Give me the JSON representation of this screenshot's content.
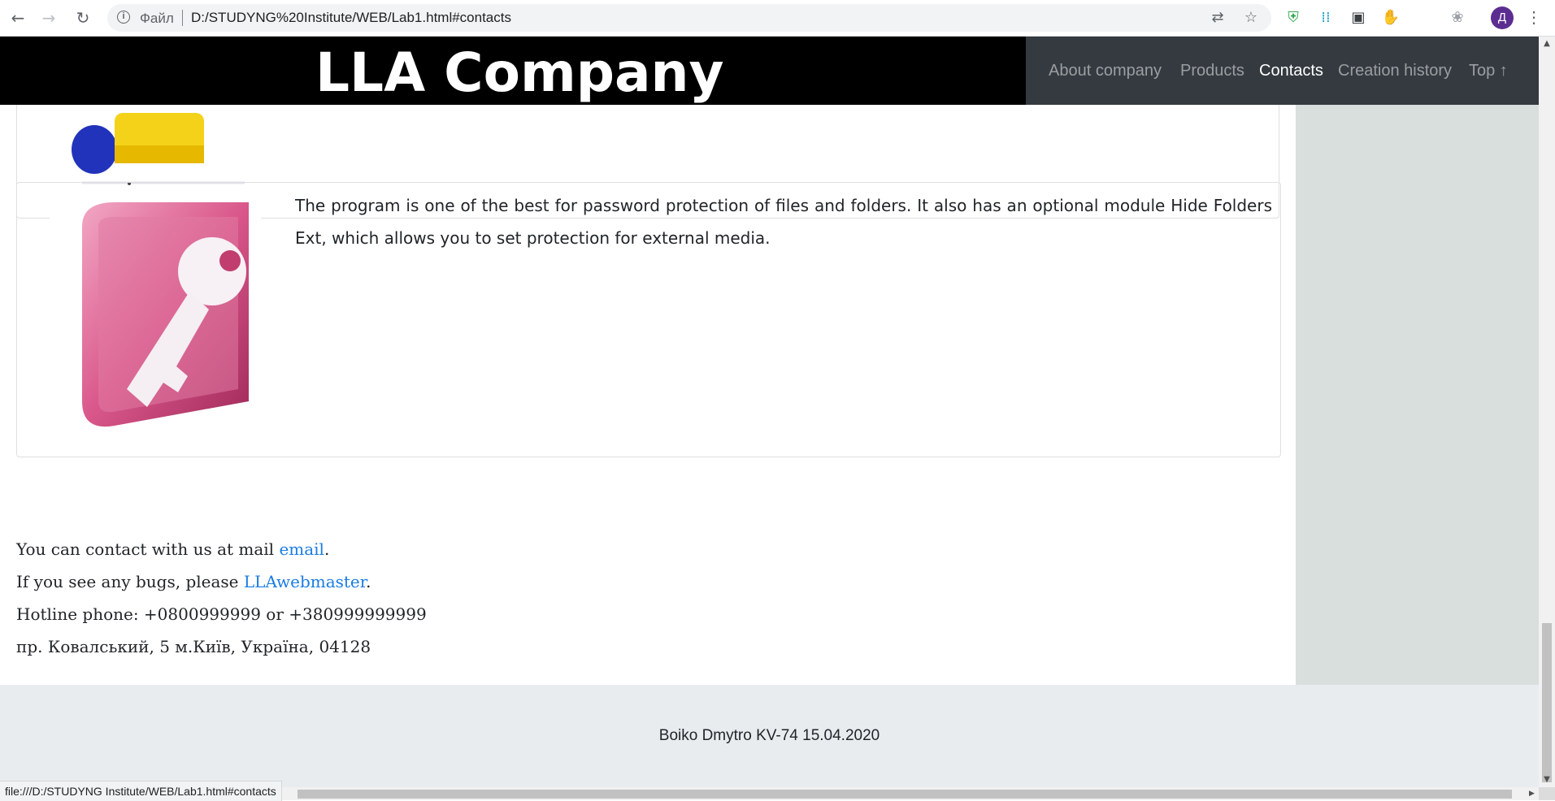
{
  "browser": {
    "file_label": "Файл",
    "url": "D:/STUDYNG%20Institute/WEB/Lab1.html#contacts",
    "avatar_letter": "Д",
    "status_url": "file:///D:/STUDYNG Institute/WEB/Lab1.html#contacts"
  },
  "header": {
    "brand": "LLA Company",
    "nav": [
      {
        "label": "About company"
      },
      {
        "label": "Products"
      },
      {
        "label": "Contacts",
        "active": true
      },
      {
        "label": "Creation history"
      },
      {
        "label": "Top ↑"
      }
    ]
  },
  "product": {
    "description": "The program is one of the best for password protection of files and folders. It also has an optional module Hide Folders Ext, which allows you to set protection for external media."
  },
  "contacts": {
    "line1_prefix": "You can contact with us at mail ",
    "line1_link": "email",
    "line1_suffix": ".",
    "line2_prefix": "If you see any bugs, please ",
    "line2_link": "LLAwebmaster",
    "line2_suffix": ".",
    "hotline": "Hotline phone: +0800999999 or +380999999999",
    "address": "пр. Ковалський, 5 м.Київ, Україна, 04128"
  },
  "footer": {
    "text": "Boiko Dmytro KV-74 15.04.2020"
  },
  "colors": {
    "header_bg": "#000000",
    "nav_bg": "#343a40",
    "link": "#1a7ce3",
    "footer_bg": "#e9ecef",
    "sidebar_bg": "#d8dfdd"
  }
}
